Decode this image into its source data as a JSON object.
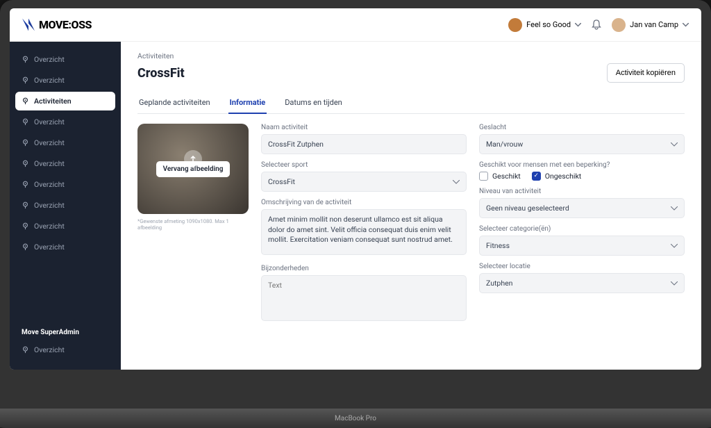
{
  "brand": "MOVE:OSS",
  "header": {
    "org_name": "Feel so Good",
    "user_name": "Jan van Camp"
  },
  "sidebar": {
    "items": [
      {
        "label": "Overzicht",
        "active": false
      },
      {
        "label": "Overzicht",
        "active": false
      },
      {
        "label": "Activiteiten",
        "active": true
      },
      {
        "label": "Overzicht",
        "active": false
      },
      {
        "label": "Overzicht",
        "active": false
      },
      {
        "label": "Overzicht",
        "active": false
      },
      {
        "label": "Overzicht",
        "active": false
      },
      {
        "label": "Overzicht",
        "active": false
      },
      {
        "label": "Overzicht",
        "active": false
      },
      {
        "label": "Overzicht",
        "active": false
      }
    ],
    "section_label": "Move SuperAdmin",
    "section_items": [
      {
        "label": "Overzicht",
        "active": false
      }
    ]
  },
  "breadcrumb": "Activiteiten",
  "page_title": "CrossFit",
  "copy_button": "Activiteit kopiëren",
  "tabs": [
    {
      "label": "Geplande activiteiten",
      "active": false
    },
    {
      "label": "Informatie",
      "active": true
    },
    {
      "label": "Datums en tijden",
      "active": false
    }
  ],
  "image_replace": "Vervang afbeelding",
  "image_caption": "*Gewenste afmeting 1090x1080. Max 1 afbeelding",
  "left": {
    "name_label": "Naam activiteit",
    "name_value": "CrossFit Zutphen",
    "sport_label": "Selecteer sport",
    "sport_value": "CrossFit",
    "desc_label": "Omschrijving van de activiteit",
    "desc_value": "Amet minim mollit non deserunt ullamco est sit aliqua dolor do amet sint. Velit officia consequat duis enim velit mollit. Exercitation veniam consequat sunt nostrud amet.",
    "special_label": "Bijzonderheden",
    "special_placeholder": "Text"
  },
  "right": {
    "gender_label": "Geslacht",
    "gender_value": "Man/vrouw",
    "suitable_label": "Geschikt voor mensen met een beperking?",
    "suitable_opt1": "Geschikt",
    "suitable_opt2": "Ongeschikt",
    "level_label": "Niveau van activiteit",
    "level_value": "Geen niveau geselecteerd",
    "category_label": "Selecteer categorie(ën)",
    "category_value": "Fitness",
    "location_label": "Selecteer locatie",
    "location_value": "Zutphen"
  },
  "laptop_label": "MacBook Pro"
}
